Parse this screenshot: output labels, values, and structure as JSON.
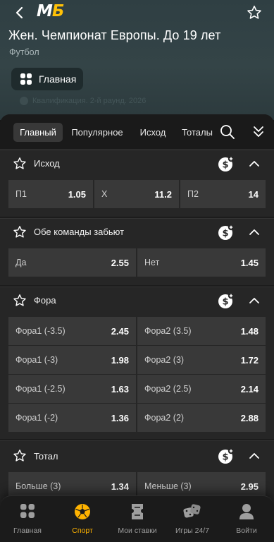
{
  "header": {
    "logo_main": "М",
    "logo_accent": "Б",
    "title": "Жен. Чемпионат Европы. До 19 лет",
    "sport": "Футбол",
    "main_chip_label": "Главная",
    "ghost_text": "Квалификация. 2-й раунд. 2026"
  },
  "tabs": [
    "Главный",
    "Популярное",
    "Исход",
    "Тоталы"
  ],
  "markets": [
    {
      "title": "Исход",
      "rows": [
        [
          {
            "name": "П1",
            "odd": "1.05"
          },
          {
            "name": "Х",
            "odd": "11.2"
          },
          {
            "name": "П2",
            "odd": "14"
          }
        ]
      ]
    },
    {
      "title": "Обе команды забьют",
      "rows": [
        [
          {
            "name": "Да",
            "odd": "2.55"
          },
          {
            "name": "Нет",
            "odd": "1.45"
          }
        ]
      ]
    },
    {
      "title": "Фора",
      "rows": [
        [
          {
            "name": "Фора1 (-3.5)",
            "odd": "2.45"
          },
          {
            "name": "Фора2 (3.5)",
            "odd": "1.48"
          }
        ],
        [
          {
            "name": "Фора1 (-3)",
            "odd": "1.98"
          },
          {
            "name": "Фора2 (3)",
            "odd": "1.72"
          }
        ],
        [
          {
            "name": "Фора1 (-2.5)",
            "odd": "1.63"
          },
          {
            "name": "Фора2 (2.5)",
            "odd": "2.14"
          }
        ],
        [
          {
            "name": "Фора1 (-2)",
            "odd": "1.36"
          },
          {
            "name": "Фора2 (2)",
            "odd": "2.88"
          }
        ]
      ]
    },
    {
      "title": "Тотал",
      "rows": [
        [
          {
            "name": "Больше (3)",
            "odd": "1.34"
          },
          {
            "name": "Меньше (3)",
            "odd": "2.95"
          }
        ]
      ]
    }
  ],
  "bottom_nav": [
    {
      "label": "Главная",
      "icon": "grid-icon"
    },
    {
      "label": "Спорт",
      "icon": "soccer-ball-icon",
      "active": true
    },
    {
      "label": "Мои ставки",
      "icon": "ticket-icon"
    },
    {
      "label": "Игры 24/7",
      "icon": "dice-icon"
    },
    {
      "label": "Войти",
      "icon": "user-icon"
    }
  ],
  "colors": {
    "accent": "#ffb300",
    "logo_accent": "#ffc107",
    "header_bg": "#344447",
    "cell_bg": "#393939"
  }
}
